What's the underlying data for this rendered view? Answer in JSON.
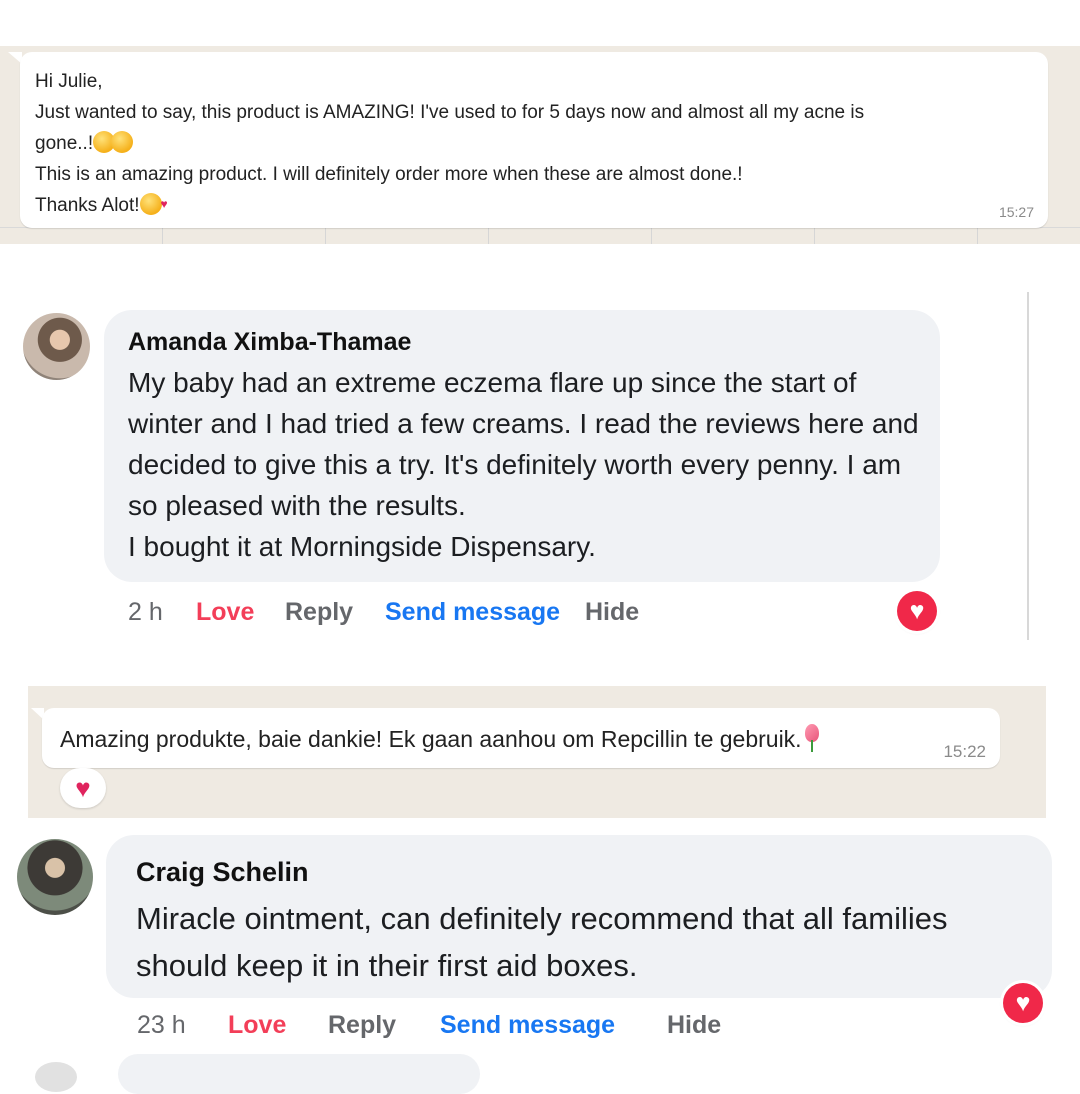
{
  "whatsapp_1": {
    "lines": [
      "Hi Julie,",
      "Just wanted to say, this product is AMAZING! I've used to for 5 days now and almost all my acne is",
      "gone..!",
      "This is an amazing product. I will definitely order more when these are almost done.!",
      "Thanks Alot!"
    ],
    "time": "15:27"
  },
  "comment_1": {
    "author": "Amanda Ximba-Thamae",
    "text": "My baby had an extreme eczema flare up since the start of winter and I had tried a few creams. I read the reviews here and decided to give this a try. It's definitely worth every penny. I am so pleased with the results.",
    "text_2": "I bought it at Morningside Dispensary.",
    "time": "2 h",
    "love": "Love",
    "reply": "Reply",
    "send": "Send message",
    "hide": "Hide"
  },
  "whatsapp_2": {
    "text": "Amazing produkte, baie dankie! Ek gaan aanhou om Repcillin te gebruik.",
    "time": "15:22"
  },
  "comment_2": {
    "author": "Craig Schelin",
    "text": "Miracle ointment, can definitely recommend that all families should keep it in their first aid boxes.",
    "time": "23 h",
    "love": "Love",
    "reply": "Reply",
    "send": "Send message",
    "hide": "Hide"
  },
  "colors": {
    "love": "#f33e58",
    "send_message": "#1877f2",
    "muted": "#65676b",
    "whatsapp_bg": "#efeae2",
    "comment_bg": "#f0f2f5"
  }
}
